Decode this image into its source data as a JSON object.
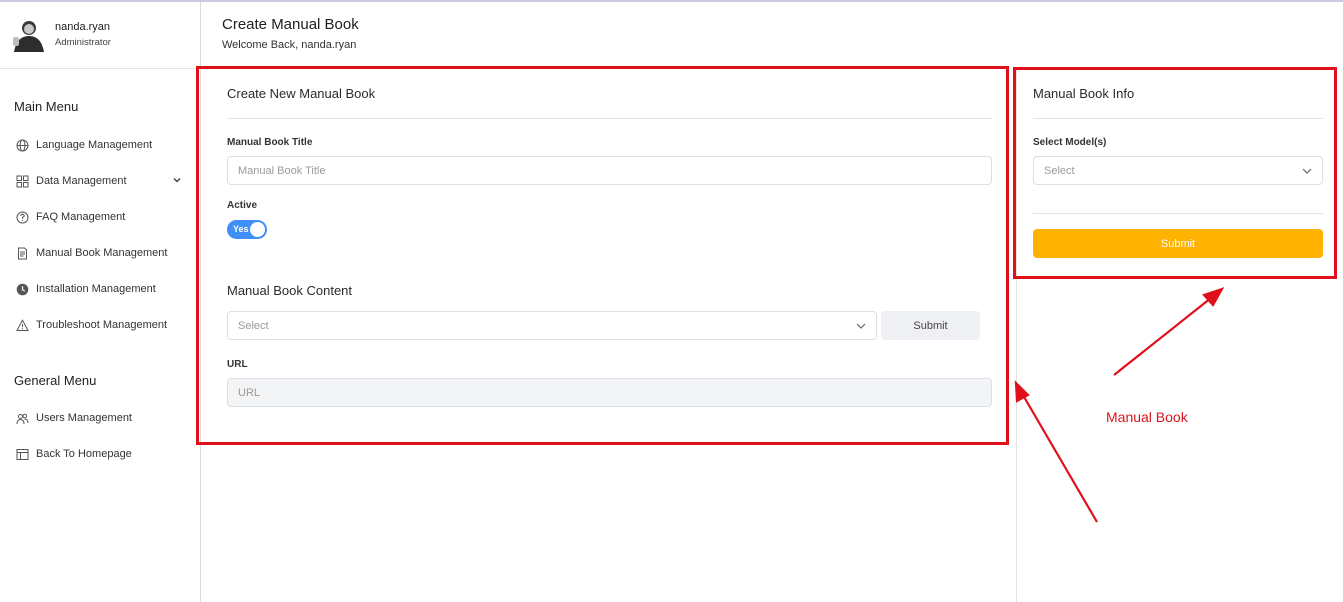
{
  "user": {
    "name": "nanda.ryan",
    "role": "Administrator"
  },
  "sidebar": {
    "main_menu_heading": "Main Menu",
    "main_items": [
      {
        "label": "Language Management",
        "icon": "globe-icon"
      },
      {
        "label": "Data Management",
        "icon": "grid-icon",
        "expandable": true
      },
      {
        "label": "FAQ Management",
        "icon": "question-circle-icon"
      },
      {
        "label": "Manual Book Management",
        "icon": "document-icon"
      },
      {
        "label": "Installation Management",
        "icon": "clock-icon"
      },
      {
        "label": "Troubleshoot Management",
        "icon": "warning-icon"
      }
    ],
    "general_menu_heading": "General Menu",
    "general_items": [
      {
        "label": "Users Management",
        "icon": "users-icon"
      },
      {
        "label": "Back To Homepage",
        "icon": "layout-icon"
      }
    ]
  },
  "header": {
    "title": "Create Manual Book",
    "subtitle": "Welcome Back, nanda.ryan"
  },
  "main_card": {
    "title": "Create New Manual Book",
    "book_title_label": "Manual Book Title",
    "book_title_placeholder": "Manual Book Title",
    "active_label": "Active",
    "active_toggle_text": "Yes",
    "active_value": true,
    "content_heading": "Manual Book Content",
    "content_select_placeholder": "Select",
    "content_submit_label": "Submit",
    "url_label": "URL",
    "url_placeholder": "URL"
  },
  "info_card": {
    "title": "Manual Book Info",
    "models_label": "Select Model(s)",
    "models_placeholder": "Select",
    "submit_label": "Submit"
  },
  "annotation": {
    "text": "Manual Book",
    "color": "#e0101a"
  },
  "colors": {
    "accent_blue": "#3f8ff6",
    "submit_yellow": "#ffb300"
  }
}
